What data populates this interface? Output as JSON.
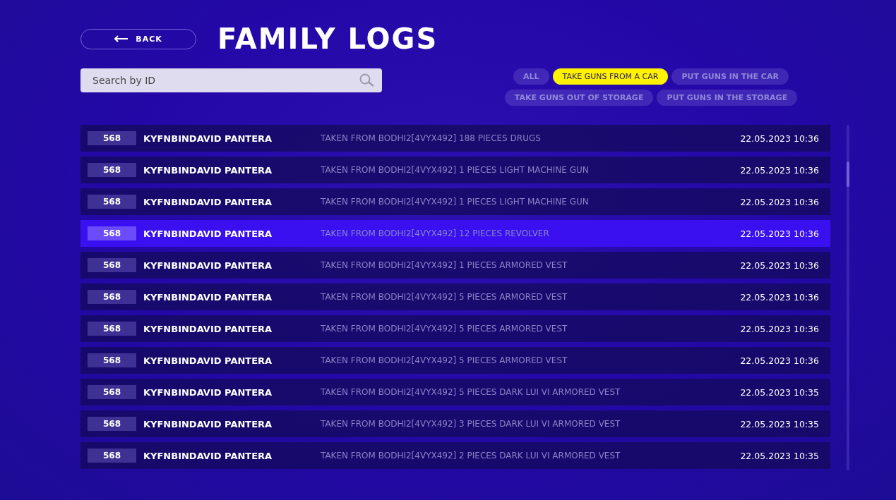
{
  "back_button": {
    "label": "BACK"
  },
  "title": "FAMILY LOGS",
  "search": {
    "placeholder": "Search by ID"
  },
  "filters": [
    {
      "label": "ALL",
      "selected": false
    },
    {
      "label": "TAKE GUNS FROM A CAR",
      "selected": true
    },
    {
      "label": "PUT GUNS IN THE CAR",
      "selected": false
    },
    {
      "label": "TAKE GUNS OUT OF STORAGE",
      "selected": false
    },
    {
      "label": "PUT GUNS IN THE STORAGE",
      "selected": false
    }
  ],
  "logs": [
    {
      "id": "568",
      "name": "KYFNBINDAVID PANTERA",
      "action": "TAKEN FROM BODHI2[4VYX492] 188 PIECES DRUGS",
      "time": "22.05.2023 10:36",
      "selected": false
    },
    {
      "id": "568",
      "name": "KYFNBINDAVID PANTERA",
      "action": "TAKEN FROM BODHI2[4VYX492] 1 PIECES LIGHT MACHINE GUN",
      "time": "22.05.2023 10:36",
      "selected": false
    },
    {
      "id": "568",
      "name": "KYFNBINDAVID PANTERA",
      "action": "TAKEN FROM BODHI2[4VYX492] 1 PIECES LIGHT MACHINE GUN",
      "time": "22.05.2023 10:36",
      "selected": false
    },
    {
      "id": "568",
      "name": "KYFNBINDAVID PANTERA",
      "action": "TAKEN FROM BODHI2[4VYX492] 12 PIECES REVOLVER",
      "time": "22.05.2023 10:36",
      "selected": true
    },
    {
      "id": "568",
      "name": "KYFNBINDAVID PANTERA",
      "action": "TAKEN FROM BODHI2[4VYX492] 1 PIECES ARMORED VEST",
      "time": "22.05.2023 10:36",
      "selected": false
    },
    {
      "id": "568",
      "name": "KYFNBINDAVID PANTERA",
      "action": "TAKEN FROM BODHI2[4VYX492] 5 PIECES ARMORED VEST",
      "time": "22.05.2023 10:36",
      "selected": false
    },
    {
      "id": "568",
      "name": "KYFNBINDAVID PANTERA",
      "action": "TAKEN FROM BODHI2[4VYX492] 5 PIECES ARMORED VEST",
      "time": "22.05.2023 10:36",
      "selected": false
    },
    {
      "id": "568",
      "name": "KYFNBINDAVID PANTERA",
      "action": "TAKEN FROM BODHI2[4VYX492] 5 PIECES ARMORED VEST",
      "time": "22.05.2023 10:36",
      "selected": false
    },
    {
      "id": "568",
      "name": "KYFNBINDAVID PANTERA",
      "action": "TAKEN FROM BODHI2[4VYX492] 5 PIECES DARK LUI VI ARMORED VEST",
      "time": "22.05.2023 10:35",
      "selected": false
    },
    {
      "id": "568",
      "name": "KYFNBINDAVID PANTERA",
      "action": "TAKEN FROM BODHI2[4VYX492] 3 PIECES DARK LUI VI ARMORED VEST",
      "time": "22.05.2023 10:35",
      "selected": false
    },
    {
      "id": "568",
      "name": "KYFNBINDAVID PANTERA",
      "action": "TAKEN FROM BODHI2[4VYX492] 2 PIECES DARK LUI VI ARMORED VEST",
      "time": "22.05.2023 10:35",
      "selected": false
    }
  ]
}
